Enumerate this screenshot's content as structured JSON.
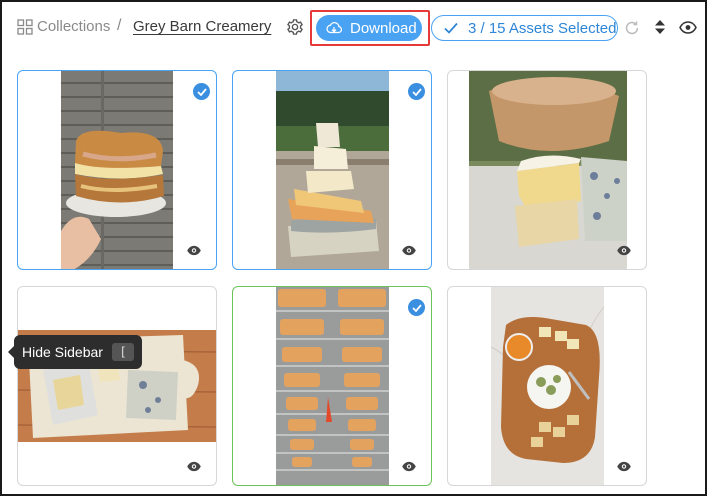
{
  "header": {
    "collections_label": "Collections",
    "separator": "/",
    "current_collection": "Grey Barn Creamery",
    "download_label": "Download",
    "selection_label": "3 / 15 Assets Selected",
    "icons": [
      "grid-icon",
      "gear-icon",
      "cloud-download-icon",
      "check-icon",
      "refresh-icon",
      "sort-icon",
      "eye-icon"
    ]
  },
  "tooltip": {
    "label": "Hide Sidebar",
    "shortcut": "["
  },
  "assets": [
    {
      "subject": "grilled cheese sandwich stack",
      "selected": true
    },
    {
      "subject": "stacked cheese slices",
      "selected": true
    },
    {
      "subject": "cheese wedges on board",
      "selected": false
    },
    {
      "subject": "cheese board with wrapped cheeses",
      "selected": false
    },
    {
      "subject": "cheese wheels on aging racks",
      "selected": true
    },
    {
      "subject": "cheese and crackers platter",
      "selected": false
    }
  ],
  "colors": {
    "accent": "#4aa3f2",
    "highlight": "#e5393a",
    "selected_green": "#6cc35a"
  }
}
